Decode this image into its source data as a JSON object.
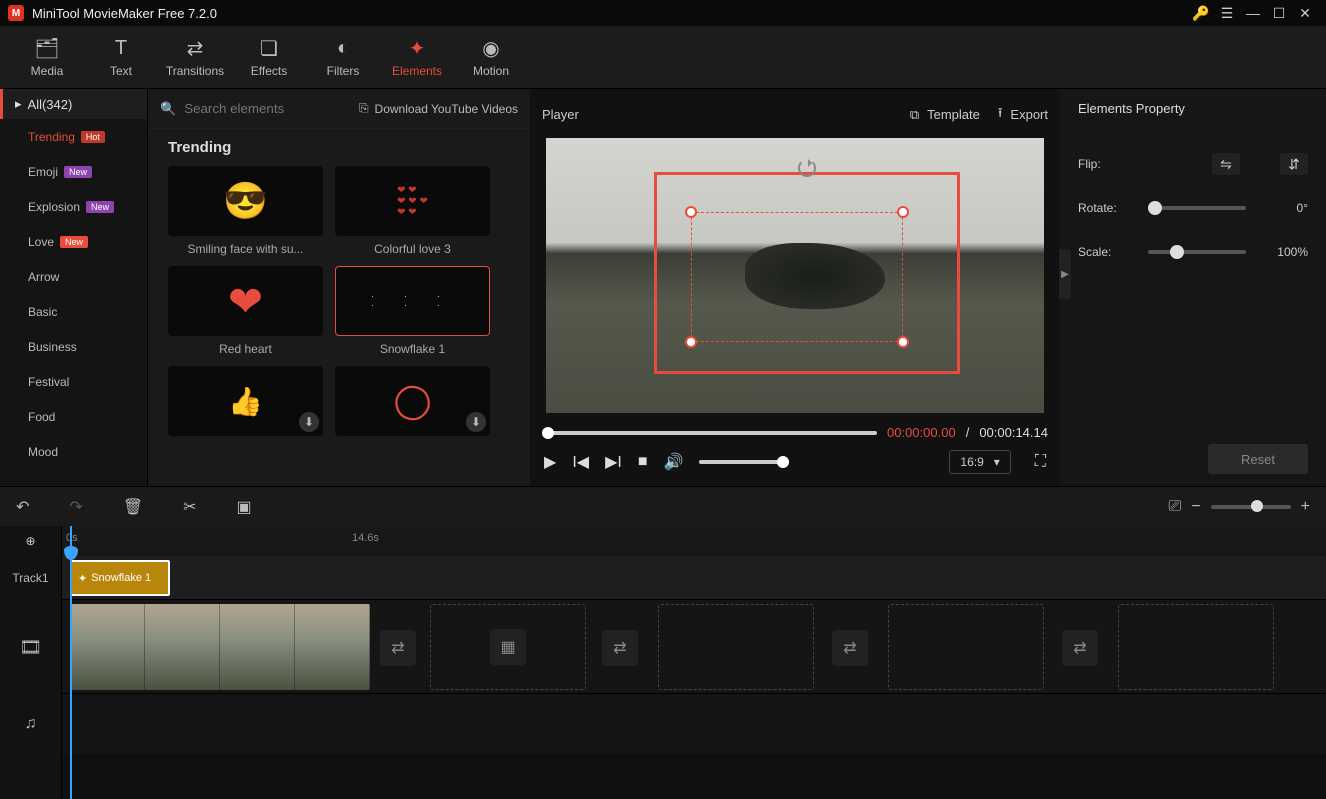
{
  "app": {
    "title": "MiniTool MovieMaker Free 7.2.0"
  },
  "nav": {
    "items": [
      {
        "label": "Media"
      },
      {
        "label": "Text"
      },
      {
        "label": "Transitions"
      },
      {
        "label": "Effects"
      },
      {
        "label": "Filters"
      },
      {
        "label": "Elements"
      },
      {
        "label": "Motion"
      }
    ],
    "active": 5
  },
  "sidebar": {
    "all_label": "All(342)",
    "cats": [
      {
        "label": "Trending",
        "badge": "Hot",
        "active": true
      },
      {
        "label": "Emoji",
        "badge": "New"
      },
      {
        "label": "Explosion",
        "badge": "New"
      },
      {
        "label": "Love",
        "badge": "New"
      },
      {
        "label": "Arrow"
      },
      {
        "label": "Basic"
      },
      {
        "label": "Business"
      },
      {
        "label": "Festival"
      },
      {
        "label": "Food"
      },
      {
        "label": "Mood"
      }
    ]
  },
  "elements": {
    "search_placeholder": "Search elements",
    "download_label": "Download YouTube Videos",
    "section": "Trending",
    "items": [
      {
        "caption": "Smiling face with su..."
      },
      {
        "caption": "Colorful love 3"
      },
      {
        "caption": "Red heart"
      },
      {
        "caption": "Snowflake 1",
        "selected": true
      },
      {
        "caption": "",
        "downloadable": true
      },
      {
        "caption": "",
        "downloadable": true
      }
    ]
  },
  "player": {
    "title": "Player",
    "template": "Template",
    "export": "Export",
    "current_time": "00:00:00.00",
    "divider": " / ",
    "total_time": "00:00:14.14",
    "aspect": "16:9"
  },
  "properties": {
    "title": "Elements Property",
    "flip_label": "Flip:",
    "rotate_label": "Rotate:",
    "rotate_value": "0°",
    "scale_label": "Scale:",
    "scale_value": "100%",
    "reset_label": "Reset"
  },
  "timeline": {
    "marks": {
      "start": "0s",
      "mid": "14.6s"
    },
    "track1_label": "Track1",
    "element_clip_label": "Snowflake 1"
  }
}
